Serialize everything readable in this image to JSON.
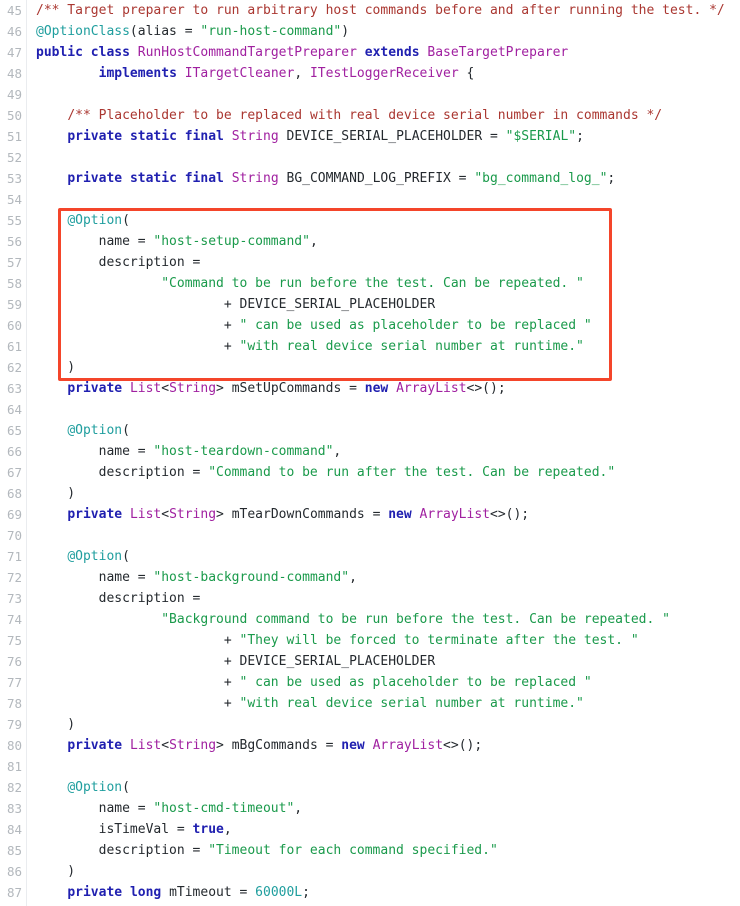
{
  "editor": {
    "language": "java",
    "first_line_number": 45,
    "last_line_number": 87,
    "gutter_color": "#b3b8bd",
    "background_color": "#ffffff",
    "text_color": "#24292e"
  },
  "syntax_colors": {
    "comment": "#aa3731",
    "keyword": "#2020b0",
    "type": "#a020a0",
    "annotation": "#1f9e9e",
    "string": "#1a9a4b",
    "number": "#1f9e9e",
    "plain": "#24292e"
  },
  "annotation_box": {
    "color": "#f4452a",
    "covers_lines": [
      55,
      62
    ],
    "label": "highlighted-code-region"
  },
  "lines": [
    {
      "n": "45",
      "tokens": [
        {
          "t": "comment",
          "s": "/** Target preparer to run arbitrary host commands before and after running the test. */"
        }
      ]
    },
    {
      "n": "46",
      "tokens": [
        {
          "t": "annot",
          "s": "@OptionClass"
        },
        {
          "t": "plain",
          "s": "("
        },
        {
          "t": "plain",
          "s": "alias"
        },
        {
          "t": "plain",
          "s": " = "
        },
        {
          "t": "string",
          "s": "\"run-host-command\""
        },
        {
          "t": "plain",
          "s": ")"
        }
      ]
    },
    {
      "n": "47",
      "tokens": [
        {
          "t": "keyword",
          "s": "public"
        },
        {
          "t": "plain",
          "s": " "
        },
        {
          "t": "keyword",
          "s": "class"
        },
        {
          "t": "plain",
          "s": " "
        },
        {
          "t": "type",
          "s": "RunHostCommandTargetPreparer"
        },
        {
          "t": "plain",
          "s": " "
        },
        {
          "t": "keyword",
          "s": "extends"
        },
        {
          "t": "plain",
          "s": " "
        },
        {
          "t": "type",
          "s": "BaseTargetPreparer"
        }
      ]
    },
    {
      "n": "48",
      "tokens": [
        {
          "t": "plain",
          "s": "        "
        },
        {
          "t": "keyword",
          "s": "implements"
        },
        {
          "t": "plain",
          "s": " "
        },
        {
          "t": "type",
          "s": "ITargetCleaner"
        },
        {
          "t": "plain",
          "s": ", "
        },
        {
          "t": "type",
          "s": "ITestLoggerReceiver"
        },
        {
          "t": "plain",
          "s": " {"
        }
      ]
    },
    {
      "n": "49",
      "tokens": []
    },
    {
      "n": "50",
      "tokens": [
        {
          "t": "plain",
          "s": "    "
        },
        {
          "t": "comment",
          "s": "/** Placeholder to be replaced with real device serial number in commands */"
        }
      ]
    },
    {
      "n": "51",
      "tokens": [
        {
          "t": "plain",
          "s": "    "
        },
        {
          "t": "keyword",
          "s": "private"
        },
        {
          "t": "plain",
          "s": " "
        },
        {
          "t": "keyword",
          "s": "static"
        },
        {
          "t": "plain",
          "s": " "
        },
        {
          "t": "keyword",
          "s": "final"
        },
        {
          "t": "plain",
          "s": " "
        },
        {
          "t": "type",
          "s": "String"
        },
        {
          "t": "plain",
          "s": " DEVICE_SERIAL_PLACEHOLDER = "
        },
        {
          "t": "string",
          "s": "\"$SERIAL\""
        },
        {
          "t": "plain",
          "s": ";"
        }
      ]
    },
    {
      "n": "52",
      "tokens": []
    },
    {
      "n": "53",
      "tokens": [
        {
          "t": "plain",
          "s": "    "
        },
        {
          "t": "keyword",
          "s": "private"
        },
        {
          "t": "plain",
          "s": " "
        },
        {
          "t": "keyword",
          "s": "static"
        },
        {
          "t": "plain",
          "s": " "
        },
        {
          "t": "keyword",
          "s": "final"
        },
        {
          "t": "plain",
          "s": " "
        },
        {
          "t": "type",
          "s": "String"
        },
        {
          "t": "plain",
          "s": " BG_COMMAND_LOG_PREFIX = "
        },
        {
          "t": "string",
          "s": "\"bg_command_log_\""
        },
        {
          "t": "plain",
          "s": ";"
        }
      ]
    },
    {
      "n": "54",
      "tokens": []
    },
    {
      "n": "55",
      "tokens": [
        {
          "t": "plain",
          "s": "    "
        },
        {
          "t": "annot",
          "s": "@Option"
        },
        {
          "t": "plain",
          "s": "("
        }
      ]
    },
    {
      "n": "56",
      "tokens": [
        {
          "t": "plain",
          "s": "        name = "
        },
        {
          "t": "string",
          "s": "\"host-setup-command\""
        },
        {
          "t": "plain",
          "s": ","
        }
      ]
    },
    {
      "n": "57",
      "tokens": [
        {
          "t": "plain",
          "s": "        description ="
        }
      ]
    },
    {
      "n": "58",
      "tokens": [
        {
          "t": "plain",
          "s": "                "
        },
        {
          "t": "string",
          "s": "\"Command to be run before the test. Can be repeated. \""
        }
      ]
    },
    {
      "n": "59",
      "tokens": [
        {
          "t": "plain",
          "s": "                        + DEVICE_SERIAL_PLACEHOLDER"
        }
      ]
    },
    {
      "n": "60",
      "tokens": [
        {
          "t": "plain",
          "s": "                        + "
        },
        {
          "t": "string",
          "s": "\" can be used as placeholder to be replaced \""
        }
      ]
    },
    {
      "n": "61",
      "tokens": [
        {
          "t": "plain",
          "s": "                        + "
        },
        {
          "t": "string",
          "s": "\"with real device serial number at runtime.\""
        }
      ]
    },
    {
      "n": "62",
      "tokens": [
        {
          "t": "plain",
          "s": "    )"
        }
      ]
    },
    {
      "n": "63",
      "tokens": [
        {
          "t": "plain",
          "s": "    "
        },
        {
          "t": "keyword",
          "s": "private"
        },
        {
          "t": "plain",
          "s": " "
        },
        {
          "t": "type",
          "s": "List"
        },
        {
          "t": "plain",
          "s": "<"
        },
        {
          "t": "type",
          "s": "String"
        },
        {
          "t": "plain",
          "s": "> mSetUpCommands = "
        },
        {
          "t": "keyword",
          "s": "new"
        },
        {
          "t": "plain",
          "s": " "
        },
        {
          "t": "type",
          "s": "ArrayList"
        },
        {
          "t": "plain",
          "s": "<>();"
        }
      ]
    },
    {
      "n": "64",
      "tokens": []
    },
    {
      "n": "65",
      "tokens": [
        {
          "t": "plain",
          "s": "    "
        },
        {
          "t": "annot",
          "s": "@Option"
        },
        {
          "t": "plain",
          "s": "("
        }
      ]
    },
    {
      "n": "66",
      "tokens": [
        {
          "t": "plain",
          "s": "        name = "
        },
        {
          "t": "string",
          "s": "\"host-teardown-command\""
        },
        {
          "t": "plain",
          "s": ","
        }
      ]
    },
    {
      "n": "67",
      "tokens": [
        {
          "t": "plain",
          "s": "        description = "
        },
        {
          "t": "string",
          "s": "\"Command to be run after the test. Can be repeated.\""
        }
      ]
    },
    {
      "n": "68",
      "tokens": [
        {
          "t": "plain",
          "s": "    )"
        }
      ]
    },
    {
      "n": "69",
      "tokens": [
        {
          "t": "plain",
          "s": "    "
        },
        {
          "t": "keyword",
          "s": "private"
        },
        {
          "t": "plain",
          "s": " "
        },
        {
          "t": "type",
          "s": "List"
        },
        {
          "t": "plain",
          "s": "<"
        },
        {
          "t": "type",
          "s": "String"
        },
        {
          "t": "plain",
          "s": "> mTearDownCommands = "
        },
        {
          "t": "keyword",
          "s": "new"
        },
        {
          "t": "plain",
          "s": " "
        },
        {
          "t": "type",
          "s": "ArrayList"
        },
        {
          "t": "plain",
          "s": "<>();"
        }
      ]
    },
    {
      "n": "70",
      "tokens": []
    },
    {
      "n": "71",
      "tokens": [
        {
          "t": "plain",
          "s": "    "
        },
        {
          "t": "annot",
          "s": "@Option"
        },
        {
          "t": "plain",
          "s": "("
        }
      ]
    },
    {
      "n": "72",
      "tokens": [
        {
          "t": "plain",
          "s": "        name = "
        },
        {
          "t": "string",
          "s": "\"host-background-command\""
        },
        {
          "t": "plain",
          "s": ","
        }
      ]
    },
    {
      "n": "73",
      "tokens": [
        {
          "t": "plain",
          "s": "        description ="
        }
      ]
    },
    {
      "n": "74",
      "tokens": [
        {
          "t": "plain",
          "s": "                "
        },
        {
          "t": "string",
          "s": "\"Background command to be run before the test. Can be repeated. \""
        }
      ]
    },
    {
      "n": "75",
      "tokens": [
        {
          "t": "plain",
          "s": "                        + "
        },
        {
          "t": "string",
          "s": "\"They will be forced to terminate after the test. \""
        }
      ]
    },
    {
      "n": "76",
      "tokens": [
        {
          "t": "plain",
          "s": "                        + DEVICE_SERIAL_PLACEHOLDER"
        }
      ]
    },
    {
      "n": "77",
      "tokens": [
        {
          "t": "plain",
          "s": "                        + "
        },
        {
          "t": "string",
          "s": "\" can be used as placeholder to be replaced \""
        }
      ]
    },
    {
      "n": "78",
      "tokens": [
        {
          "t": "plain",
          "s": "                        + "
        },
        {
          "t": "string",
          "s": "\"with real device serial number at runtime.\""
        }
      ]
    },
    {
      "n": "79",
      "tokens": [
        {
          "t": "plain",
          "s": "    )"
        }
      ]
    },
    {
      "n": "80",
      "tokens": [
        {
          "t": "plain",
          "s": "    "
        },
        {
          "t": "keyword",
          "s": "private"
        },
        {
          "t": "plain",
          "s": " "
        },
        {
          "t": "type",
          "s": "List"
        },
        {
          "t": "plain",
          "s": "<"
        },
        {
          "t": "type",
          "s": "String"
        },
        {
          "t": "plain",
          "s": "> mBgCommands = "
        },
        {
          "t": "keyword",
          "s": "new"
        },
        {
          "t": "plain",
          "s": " "
        },
        {
          "t": "type",
          "s": "ArrayList"
        },
        {
          "t": "plain",
          "s": "<>();"
        }
      ]
    },
    {
      "n": "81",
      "tokens": []
    },
    {
      "n": "82",
      "tokens": [
        {
          "t": "plain",
          "s": "    "
        },
        {
          "t": "annot",
          "s": "@Option"
        },
        {
          "t": "plain",
          "s": "("
        }
      ]
    },
    {
      "n": "83",
      "tokens": [
        {
          "t": "plain",
          "s": "        name = "
        },
        {
          "t": "string",
          "s": "\"host-cmd-timeout\""
        },
        {
          "t": "plain",
          "s": ","
        }
      ]
    },
    {
      "n": "84",
      "tokens": [
        {
          "t": "plain",
          "s": "        isTimeVal = "
        },
        {
          "t": "keyword",
          "s": "true"
        },
        {
          "t": "plain",
          "s": ","
        }
      ]
    },
    {
      "n": "85",
      "tokens": [
        {
          "t": "plain",
          "s": "        description = "
        },
        {
          "t": "string",
          "s": "\"Timeout for each command specified.\""
        }
      ]
    },
    {
      "n": "86",
      "tokens": [
        {
          "t": "plain",
          "s": "    )"
        }
      ]
    },
    {
      "n": "87",
      "tokens": [
        {
          "t": "plain",
          "s": "    "
        },
        {
          "t": "keyword",
          "s": "private"
        },
        {
          "t": "plain",
          "s": " "
        },
        {
          "t": "keyword",
          "s": "long"
        },
        {
          "t": "plain",
          "s": " mTimeout = "
        },
        {
          "t": "number",
          "s": "60000L"
        },
        {
          "t": "plain",
          "s": ";"
        }
      ]
    }
  ]
}
